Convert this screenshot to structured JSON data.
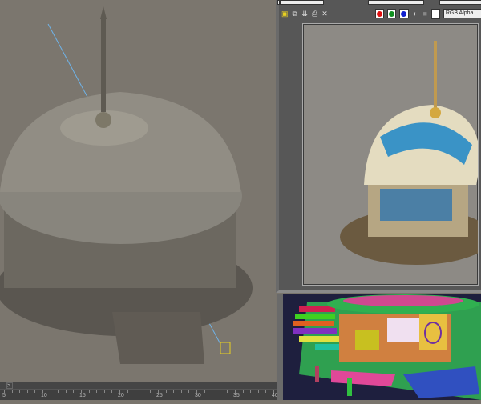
{
  "viewport": {
    "name": "perspective-viewport"
  },
  "timeline": {
    "next_label": ">",
    "ticks": [
      "5",
      "10",
      "15",
      "20",
      "25",
      "30",
      "35",
      "40"
    ]
  },
  "render_window": {
    "toolbar": {
      "icons": [
        "save-image-icon",
        "copy-image-icon",
        "clone-window-icon",
        "print-icon",
        "clear-icon"
      ],
      "channel_display": "RGB Alpha"
    },
    "colors": {
      "red": "#e01010",
      "green": "#109020",
      "blue": "#1020d0"
    }
  }
}
